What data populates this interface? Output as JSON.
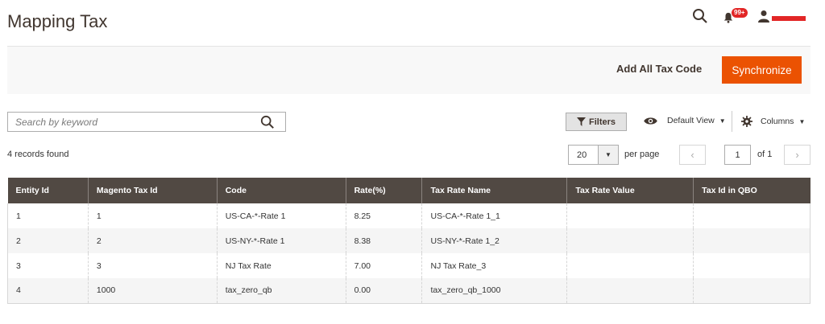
{
  "header": {
    "title": "Mapping Tax",
    "notifications_count": "99+"
  },
  "actions": {
    "add_all_label": "Add All Tax Code",
    "synchronize_label": "Synchronize"
  },
  "toolbar": {
    "search_placeholder": "Search by keyword",
    "filters_label": "Filters",
    "default_view_label": "Default View",
    "columns_label": "Columns"
  },
  "pagination": {
    "records_found": "4 records found",
    "per_page_value": "20",
    "per_page_label": "per page",
    "current_page": "1",
    "of_pages": "of 1"
  },
  "grid": {
    "columns": [
      "Entity Id",
      "Magento Tax Id",
      "Code",
      "Rate(%)",
      "Tax Rate Name",
      "Tax Rate Value",
      "Tax Id in QBO"
    ],
    "rows": [
      [
        "1",
        "1",
        "US-CA-*-Rate 1",
        "8.25",
        "US-CA-*-Rate 1_1",
        "",
        ""
      ],
      [
        "2",
        "2",
        "US-NY-*-Rate 1",
        "8.38",
        "US-NY-*-Rate 1_2",
        "",
        ""
      ],
      [
        "3",
        "3",
        "NJ Tax Rate",
        "7.00",
        "NJ Tax Rate_3",
        "",
        ""
      ],
      [
        "4",
        "1000",
        "tax_zero_qb",
        "0.00",
        "tax_zero_qb_1000",
        "",
        ""
      ]
    ]
  },
  "colors": {
    "accent": "#eb5202",
    "header_bg": "#514943",
    "badge": "#e22626"
  }
}
